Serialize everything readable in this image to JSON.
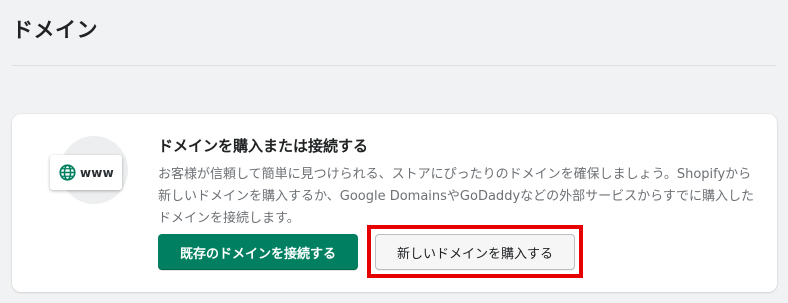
{
  "header": {
    "title": "ドメイン"
  },
  "card": {
    "illustration": {
      "icon": "globe-icon",
      "chip_text": "www"
    },
    "title": "ドメインを購入または接続する",
    "description": "お客様が信頼して簡単に見つけられる、ストアにぴったりのドメインを確保しましょう。Shopifyから新しいドメインを購入するか、Google DomainsやGoDaddyなどの外部サービスからすでに購入したドメインを接続します。",
    "primary_button": "既存のドメインを接続する",
    "secondary_button": "新しいドメインを購入する"
  },
  "colors": {
    "background": "#f1f2f3",
    "primary": "#008060",
    "highlight": "#e60000"
  }
}
